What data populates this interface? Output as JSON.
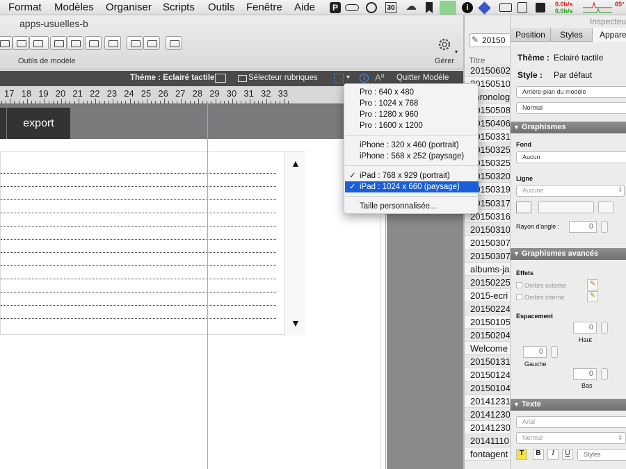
{
  "menubar": {
    "items": [
      "Format",
      "Modèles",
      "Organiser",
      "Scripts",
      "Outils",
      "Fenêtre",
      "Aide"
    ],
    "tray": {
      "calendar_day": "30",
      "net_up": "0.0b/s",
      "net_down": "0.0b/s",
      "temp": "65°"
    }
  },
  "window": {
    "title": "apps-usuelles-b",
    "toolbar_group_label": "Outils de modèle",
    "manage_label": "Gérer"
  },
  "layout_bar": {
    "theme_label": "Thème : Eclairé tactile",
    "field_picker": "Sélecteur rubriques",
    "font_glyph": "Aª",
    "exit_label": "Quitter Modèle"
  },
  "ruler": {
    "numbers": [
      "17",
      "18",
      "19",
      "20",
      "21",
      "22",
      "23",
      "24",
      "25",
      "26",
      "27",
      "28",
      "29",
      "30",
      "31",
      "32",
      "33"
    ]
  },
  "canvas": {
    "export_button": "export"
  },
  "dropdown": {
    "groups": [
      [
        {
          "label": "Pro : 640 x 480",
          "checked": false
        },
        {
          "label": "Pro : 1024 x 768",
          "checked": false
        },
        {
          "label": "Pro : 1280 x 960",
          "checked": false
        },
        {
          "label": "Pro : 1600 x 1200",
          "checked": false
        }
      ],
      [
        {
          "label": "iPhone : 320 x 460 (portrait)",
          "checked": false
        },
        {
          "label": "iPhone : 568 x 252 (paysage)",
          "checked": false
        }
      ],
      [
        {
          "label": "iPad : 768 x 929 (portrait)",
          "checked": true
        },
        {
          "label": "iPad : 1024 x 660 (paysage)",
          "checked": true,
          "selected": true
        }
      ],
      [
        {
          "label": "Taille personnalisée...",
          "checked": false
        }
      ]
    ]
  },
  "records": {
    "header": "Titre",
    "items": [
      "20150602",
      "20150510",
      "chronolog",
      "20150508",
      "20150406",
      "20150331",
      "20150325",
      "20150325",
      "20150320",
      "20150319",
      "20150317",
      "20150316",
      "20150310",
      "20150307",
      "20150307",
      "albums-ja",
      "20150225",
      "2015-ecri",
      "20150224",
      "20150105",
      "20150204",
      "Welcome",
      "20150131",
      "20150124",
      "20150104",
      "20141231",
      "20141230",
      "20141230",
      "20141110",
      "fontagent"
    ],
    "search_value": "20150"
  },
  "inspector": {
    "title": "Inspecteur",
    "tabs": [
      "Position",
      "Styles",
      "Appare"
    ],
    "theme_key": "Thème :",
    "theme_value": "Eclairé tactile",
    "style_key": "Style :",
    "style_value": "Par défaut",
    "bg_select": "Arrière-plan du modèle",
    "state_select": "Normal",
    "graphics": {
      "header": "Graphismes",
      "fill_label": "Fond",
      "fill_value": "Aucun",
      "line_label": "Ligne",
      "line_value": "Aucune",
      "radius_label": "Rayon d'angle :",
      "radius_value": "0"
    },
    "advanced": {
      "header": "Graphismes avancés",
      "effects_label": "Effets",
      "outer_shadow": "Ombre externe",
      "inner_shadow": "Ombre interne",
      "spacing_label": "Espacement",
      "top_value": "0",
      "top_label": "Haut",
      "left_value": "0",
      "left_label": "Gauche",
      "bottom_value": "0",
      "bottom_label": "Bas"
    },
    "text": {
      "header": "Texte",
      "font": "Arial",
      "weight": "Normal",
      "styles_btn": "Styles",
      "b": "B",
      "i": "I",
      "u": "U",
      "t": "T"
    }
  },
  "colors": {
    "accent": "#1a5fd8",
    "guide": "#e8a317",
    "dark_bar": "#4a4a4a"
  }
}
